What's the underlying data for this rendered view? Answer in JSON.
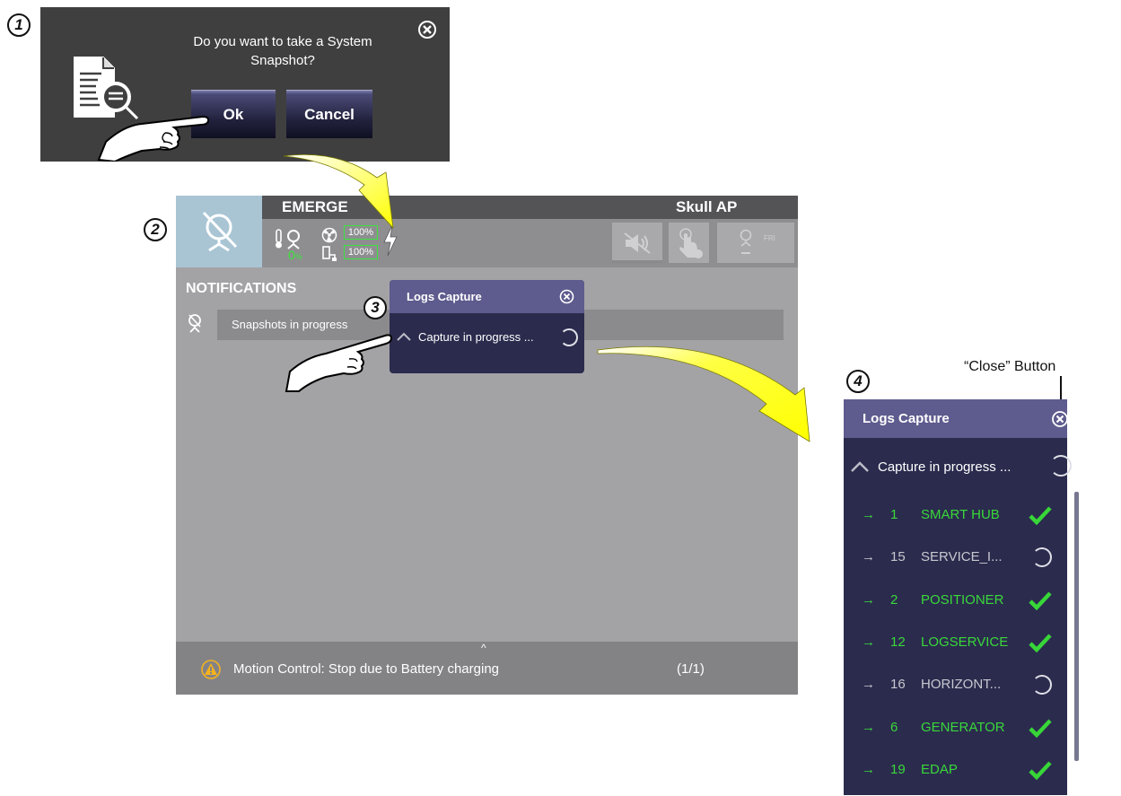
{
  "steps": [
    "1",
    "2",
    "3",
    "4"
  ],
  "snapshot_dialog": {
    "question": "Do you want to take a System Snapshot?",
    "ok_label": "Ok",
    "cancel_label": "Cancel",
    "icons": [
      "close-icon",
      "document-search-icon",
      "pointing-hand-icon"
    ]
  },
  "device_screen": {
    "status_title": "EMERGE",
    "system_name": "Skull AP",
    "gauge_value": "0",
    "gauge_unit": "%",
    "battery_top": "100%",
    "battery_bottom": "100%",
    "fr_label": "FRI",
    "notifications_heading": "NOTIFICATIONS",
    "notification_text": "Snapshots in progress",
    "footer_caret": "^",
    "footer_message": "Motion Control: Stop due to Battery charging",
    "footer_count": "(1/1)",
    "colors": {
      "green": "#3ce43c",
      "warning": "#f5b21e",
      "bolt": "#ffffff"
    },
    "icons": [
      "generator-off-icon",
      "thermometer-icon",
      "radiation-icon",
      "battery-icon",
      "lightning-icon",
      "mute-icon",
      "touch-icon",
      "generator-icon",
      "warning-icon"
    ]
  },
  "logs_small": {
    "title": "Logs Capture",
    "status": "Capture in progress ..."
  },
  "logs_large": {
    "callout": "“Close” Button",
    "title": "Logs Capture",
    "status": "Capture in progress ...",
    "items": [
      {
        "num": "1",
        "name": "SMART HUB",
        "state": "done"
      },
      {
        "num": "15",
        "name": "SERVICE_I...",
        "state": "pending"
      },
      {
        "num": "2",
        "name": "POSITIONER",
        "state": "done"
      },
      {
        "num": "12",
        "name": "LOGSERVICE",
        "state": "done"
      },
      {
        "num": "16",
        "name": "HORIZONT...",
        "state": "pending"
      },
      {
        "num": "6",
        "name": "GENERATOR",
        "state": "done"
      },
      {
        "num": "19",
        "name": "EDAP",
        "state": "done"
      }
    ],
    "arrow": "→",
    "colors": {
      "done": "#39d839",
      "pending": "#c8c8d0",
      "check": "#38d638"
    }
  }
}
